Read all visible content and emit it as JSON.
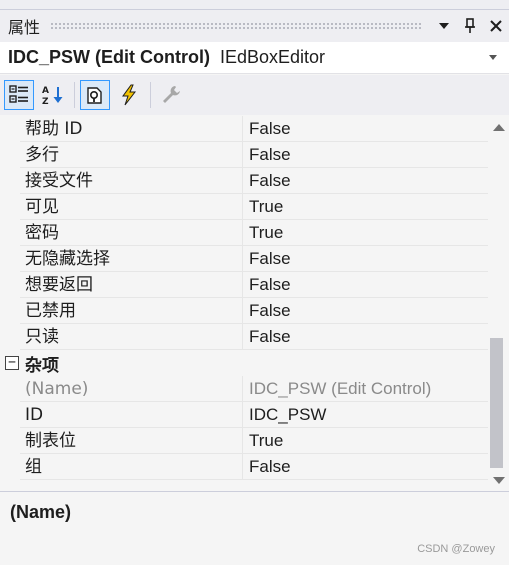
{
  "panel": {
    "title": "属性",
    "icons": [
      "dropdown-arrow-icon",
      "pin-icon",
      "close-icon"
    ]
  },
  "selector": {
    "object_name": "IDC_PSW (Edit Control)",
    "object_type": "IEdBoxEditor"
  },
  "toolbar": {
    "buttons": [
      {
        "name": "categorized-view-button",
        "icon": "categorized-icon",
        "active": true
      },
      {
        "name": "alphabetical-view-button",
        "icon": "sort-az-icon",
        "active": false
      },
      {
        "name": "properties-button",
        "icon": "properties-page-icon",
        "active": true
      },
      {
        "name": "events-button",
        "icon": "lightning-icon",
        "active": false
      },
      {
        "name": "property-pages-button",
        "icon": "wrench-icon",
        "active": false
      }
    ]
  },
  "grid": {
    "rows_before": [
      {
        "name": "帮助 ID",
        "value": "False"
      },
      {
        "name": "多行",
        "value": "False"
      },
      {
        "name": "接受文件",
        "value": "False"
      },
      {
        "name": "可见",
        "value": "True"
      },
      {
        "name": "密码",
        "value": "True"
      },
      {
        "name": "无隐藏选择",
        "value": "False"
      },
      {
        "name": "想要返回",
        "value": "False"
      },
      {
        "name": "已禁用",
        "value": "False"
      },
      {
        "name": "只读",
        "value": "False"
      }
    ],
    "category": {
      "toggle": "−",
      "label": "杂项"
    },
    "rows_after": [
      {
        "name": "(Name)",
        "value": "IDC_PSW (Edit Control)",
        "readonly": true
      },
      {
        "name": "ID",
        "value": "IDC_PSW"
      },
      {
        "name": "制表位",
        "value": "True"
      },
      {
        "name": "组",
        "value": "False"
      }
    ]
  },
  "description": {
    "title": "(Name)"
  },
  "watermark": "CSDN @Zowey",
  "colors": {
    "accent": "#3399ff",
    "readonly_text": "#8a8a8a",
    "scroll_thumb": "#c2c3c9"
  }
}
